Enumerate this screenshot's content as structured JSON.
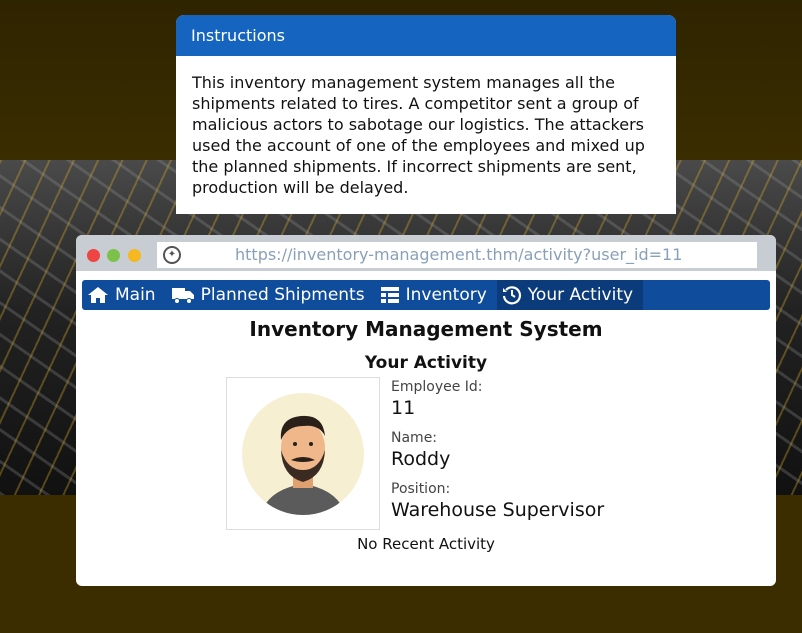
{
  "instructions": {
    "title": "Instructions",
    "body": "This inventory management system manages all the shipments related to tires. A competitor sent a group of malicious actors to sabotage our logistics. The attackers used the account of one of the employees and mixed up the planned shipments. If incorrect shipments are sent, production will be delayed."
  },
  "browser": {
    "url": "https://inventory-management.thm/activity?user_id=11"
  },
  "nav": {
    "items": [
      {
        "label": "Main",
        "icon": "home-icon"
      },
      {
        "label": "Planned Shipments",
        "icon": "truck-icon"
      },
      {
        "label": "Inventory",
        "icon": "table-icon"
      },
      {
        "label": "Your Activity",
        "icon": "history-icon"
      }
    ],
    "active": "Your Activity"
  },
  "page": {
    "title": "Inventory Management System",
    "section": "Your Activity",
    "employee_id_label": "Employee Id:",
    "employee_id": "11",
    "name_label": "Name:",
    "name": "Roddy",
    "position_label": "Position:",
    "position": "Warehouse Supervisor",
    "activity": "No Recent Activity"
  },
  "colors": {
    "header_blue": "#1565c0",
    "nav_blue": "#0f4c9c",
    "nav_active": "#0b3b7a"
  }
}
